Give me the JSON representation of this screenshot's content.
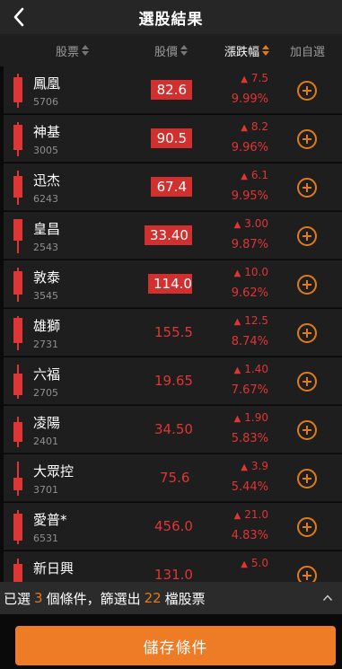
{
  "header": {
    "title": "選股結果"
  },
  "columns": {
    "stock": "股票",
    "price": "股價",
    "change": "漲跌幅",
    "add": "加自選"
  },
  "colors": {
    "up": "#e03535",
    "accent": "#ee7b25",
    "highlight": "#d22f2f"
  },
  "rows": [
    {
      "name": "鳳凰",
      "code": "5706",
      "price": "82.6",
      "highlight": true,
      "change": "7.5",
      "pct": "9.99%"
    },
    {
      "name": "神基",
      "code": "3005",
      "price": "90.5",
      "highlight": true,
      "change": "8.2",
      "pct": "9.96%"
    },
    {
      "name": "迅杰",
      "code": "6243",
      "price": "67.4",
      "highlight": true,
      "change": "6.1",
      "pct": "9.95%"
    },
    {
      "name": "皇昌",
      "code": "2543",
      "price": "33.40",
      "highlight": true,
      "change": "3.00",
      "pct": "9.87%"
    },
    {
      "name": "敦泰",
      "code": "3545",
      "price": "114.0",
      "highlight": true,
      "change": "10.0",
      "pct": "9.62%"
    },
    {
      "name": "雄獅",
      "code": "2731",
      "price": "155.5",
      "highlight": false,
      "change": "12.5",
      "pct": "8.74%"
    },
    {
      "name": "六福",
      "code": "2705",
      "price": "19.65",
      "highlight": false,
      "change": "1.40",
      "pct": "7.67%"
    },
    {
      "name": "凌陽",
      "code": "2401",
      "price": "34.50",
      "highlight": false,
      "change": "1.90",
      "pct": "5.83%"
    },
    {
      "name": "大眾控",
      "code": "3701",
      "price": "75.6",
      "highlight": false,
      "change": "3.9",
      "pct": "5.44%"
    },
    {
      "name": "愛普*",
      "code": "6531",
      "price": "456.0",
      "highlight": false,
      "change": "21.0",
      "pct": "4.83%"
    },
    {
      "name": "新日興",
      "code": "",
      "price": "131.0",
      "highlight": false,
      "change": "5.0",
      "pct": ""
    }
  ],
  "summary": {
    "prefix": "已選",
    "conditions_count": "3",
    "middle": "個條件，篩選出",
    "stocks_count": "22",
    "suffix": "檔股票"
  },
  "footer": {
    "save_label": "儲存條件"
  },
  "icons": {
    "back": "chevron-left-icon",
    "add": "plus-circle-icon",
    "expand": "chevron-up-icon",
    "up": "triangle-up-icon"
  }
}
